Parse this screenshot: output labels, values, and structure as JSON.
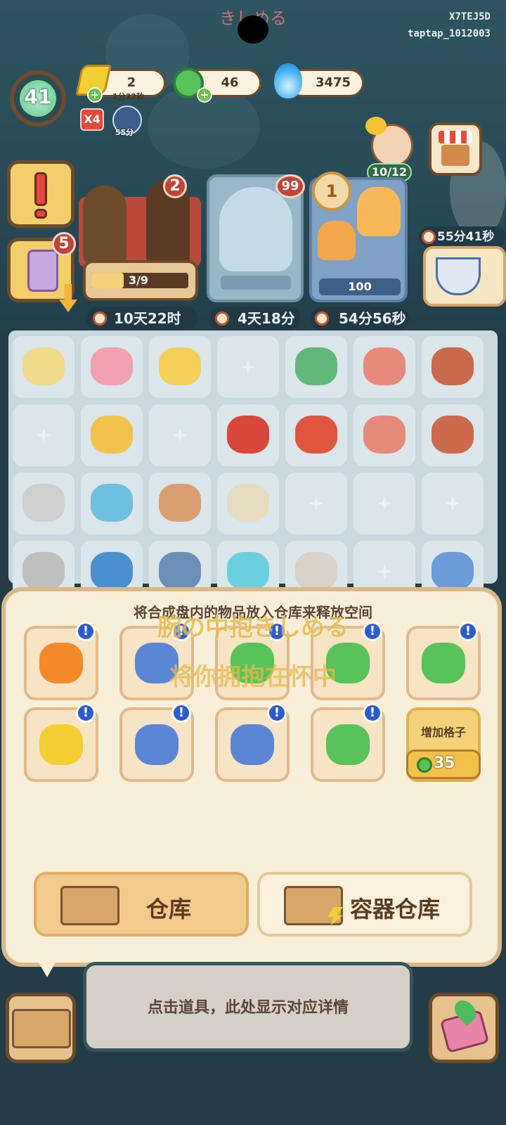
{
  "overlay": {
    "top_lyric": "きしめる",
    "user_code": "X7TEJ5D",
    "user_account": "taptap_1012003"
  },
  "level": {
    "value": "41"
  },
  "resources": {
    "energy": {
      "value": "2",
      "timer": "1分32秒"
    },
    "coins": {
      "value": "46"
    },
    "gems": {
      "value": "3475"
    }
  },
  "boosts": {
    "multiplier": "X4",
    "lightning_timer": "55分"
  },
  "customer": {
    "progress_text": "10/12",
    "timer": "55分41秒"
  },
  "side_stack": {
    "count": "5"
  },
  "orders": [
    {
      "badge": "2",
      "progress_text": "3/9",
      "progress_fraction": 0.33,
      "timer": "10天22时"
    },
    {
      "badge": "99",
      "timer": "4天18分"
    },
    {
      "badge": "1",
      "value": "100",
      "timer": "54分56秒"
    }
  ],
  "panel": {
    "title": "将合成盘内的物品放入仓库来释放空间",
    "lyric_line1": "腕の中抱きしめる",
    "lyric_line2": "将你拥抱在怀中",
    "add_slot_label": "增加格子",
    "add_slot_cost": "35",
    "info_mark": "!",
    "warehouse_label": "仓库",
    "container_warehouse_label": "容器仓库"
  },
  "detail_text": "点击道具，此处显示对应详情",
  "colors": {
    "panel_bg": "#f8efd8",
    "info_badge": "#2f5bd0",
    "red_badge": "#c54238",
    "coin_green": "#58c35a"
  }
}
